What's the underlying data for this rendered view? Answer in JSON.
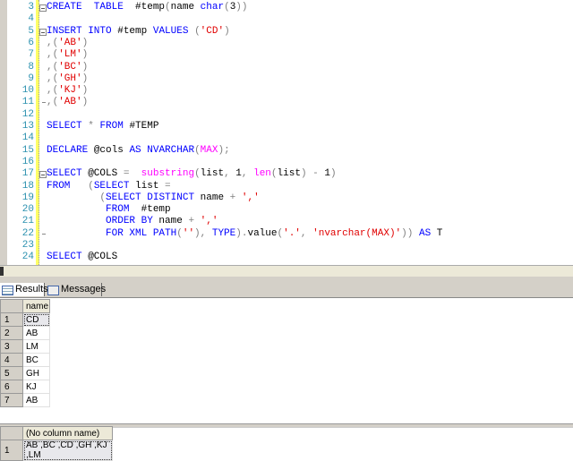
{
  "editor": {
    "lines": [
      {
        "n": "3",
        "fold": "start",
        "t": [
          [
            "kw",
            "CREATE  TABLE"
          ],
          [
            "tx",
            "  #temp"
          ],
          [
            "op",
            "("
          ],
          [
            "tx",
            "name "
          ],
          [
            "kw",
            "char"
          ],
          [
            "op",
            "("
          ],
          [
            "tx",
            "3"
          ],
          [
            "op",
            "))"
          ]
        ]
      },
      {
        "n": "4",
        "t": []
      },
      {
        "n": "5",
        "fold": "start",
        "t": [
          [
            "kw",
            "INSERT INTO"
          ],
          [
            "tx",
            " #temp "
          ],
          [
            "kw",
            "VALUES"
          ],
          [
            "tx",
            " "
          ],
          [
            "op",
            "("
          ],
          [
            "str",
            "'CD'"
          ],
          [
            "op",
            ")"
          ]
        ]
      },
      {
        "n": "6",
        "t": [
          [
            "op",
            ",("
          ],
          [
            "str",
            "'AB'"
          ],
          [
            "op",
            ")"
          ]
        ]
      },
      {
        "n": "7",
        "t": [
          [
            "op",
            ",("
          ],
          [
            "str",
            "'LM'"
          ],
          [
            "op",
            ")"
          ]
        ]
      },
      {
        "n": "8",
        "t": [
          [
            "op",
            ",("
          ],
          [
            "str",
            "'BC'"
          ],
          [
            "op",
            ")"
          ]
        ]
      },
      {
        "n": "9",
        "t": [
          [
            "op",
            ",("
          ],
          [
            "str",
            "'GH'"
          ],
          [
            "op",
            ")"
          ]
        ]
      },
      {
        "n": "10",
        "t": [
          [
            "op",
            ",("
          ],
          [
            "str",
            "'KJ'"
          ],
          [
            "op",
            ")"
          ]
        ]
      },
      {
        "n": "11",
        "fold": "end",
        "t": [
          [
            "op",
            ",("
          ],
          [
            "str",
            "'AB'"
          ],
          [
            "op",
            ")"
          ]
        ]
      },
      {
        "n": "12",
        "t": []
      },
      {
        "n": "13",
        "t": [
          [
            "kw",
            "SELECT"
          ],
          [
            "tx",
            " "
          ],
          [
            "op",
            "*"
          ],
          [
            "tx",
            " "
          ],
          [
            "kw",
            "FROM"
          ],
          [
            "tx",
            " #TEMP"
          ]
        ]
      },
      {
        "n": "14",
        "t": []
      },
      {
        "n": "15",
        "t": [
          [
            "kw",
            "DECLARE"
          ],
          [
            "tx",
            " @cols "
          ],
          [
            "kw",
            "AS NVARCHAR"
          ],
          [
            "op",
            "("
          ],
          [
            "fn",
            "MAX"
          ],
          [
            "op",
            ");"
          ]
        ]
      },
      {
        "n": "16",
        "t": []
      },
      {
        "n": "17",
        "fold": "start",
        "t": [
          [
            "kw",
            "SELECT"
          ],
          [
            "tx",
            " @COLS "
          ],
          [
            "op",
            "="
          ],
          [
            "tx",
            "  "
          ],
          [
            "fn",
            "substring"
          ],
          [
            "op",
            "("
          ],
          [
            "tx",
            "list"
          ],
          [
            "op",
            ","
          ],
          [
            "tx",
            " 1"
          ],
          [
            "op",
            ","
          ],
          [
            "tx",
            " "
          ],
          [
            "fn",
            "len"
          ],
          [
            "op",
            "("
          ],
          [
            "tx",
            "list"
          ],
          [
            "op",
            ")"
          ],
          [
            "tx",
            " "
          ],
          [
            "op",
            "-"
          ],
          [
            "tx",
            " 1"
          ],
          [
            "op",
            ")"
          ]
        ]
      },
      {
        "n": "18",
        "t": [
          [
            "kw",
            "FROM"
          ],
          [
            "tx",
            "   "
          ],
          [
            "op",
            "("
          ],
          [
            "kw",
            "SELECT"
          ],
          [
            "tx",
            " list "
          ],
          [
            "op",
            "="
          ]
        ]
      },
      {
        "n": "19",
        "t": [
          [
            "tx",
            "         "
          ],
          [
            "op",
            "("
          ],
          [
            "kw",
            "SELECT DISTINCT"
          ],
          [
            "tx",
            " name "
          ],
          [
            "op",
            "+"
          ],
          [
            "tx",
            " "
          ],
          [
            "str",
            "','"
          ]
        ]
      },
      {
        "n": "20",
        "t": [
          [
            "tx",
            "          "
          ],
          [
            "kw",
            "FROM"
          ],
          [
            "tx",
            "  #temp"
          ]
        ]
      },
      {
        "n": "21",
        "t": [
          [
            "tx",
            "          "
          ],
          [
            "kw",
            "ORDER BY"
          ],
          [
            "tx",
            " name "
          ],
          [
            "op",
            "+"
          ],
          [
            "tx",
            " "
          ],
          [
            "str",
            "','"
          ]
        ]
      },
      {
        "n": "22",
        "fold": "end",
        "t": [
          [
            "tx",
            "          "
          ],
          [
            "kw",
            "FOR XML PATH"
          ],
          [
            "op",
            "("
          ],
          [
            "str",
            "''"
          ],
          [
            "op",
            "),"
          ],
          [
            "tx",
            " "
          ],
          [
            "kw",
            "TYPE"
          ],
          [
            "op",
            ")."
          ],
          [
            "tx",
            "value"
          ],
          [
            "op",
            "("
          ],
          [
            "str",
            "'.'"
          ],
          [
            "op",
            ","
          ],
          [
            "tx",
            " "
          ],
          [
            "str",
            "'nvarchar(MAX)'"
          ],
          [
            "op",
            "))"
          ],
          [
            "tx",
            " "
          ],
          [
            "kw",
            "AS"
          ],
          [
            "tx",
            " T"
          ]
        ]
      },
      {
        "n": "23",
        "t": []
      },
      {
        "n": "24",
        "t": [
          [
            "kw",
            "SELECT"
          ],
          [
            "tx",
            " @COLS"
          ]
        ]
      }
    ]
  },
  "tabs": [
    {
      "label": "Results",
      "icon": "grid-icon"
    },
    {
      "label": "Messages",
      "icon": "messages-icon"
    }
  ],
  "grid1": {
    "header": "name",
    "rows": [
      [
        "1",
        "CD"
      ],
      [
        "2",
        "AB"
      ],
      [
        "3",
        "LM"
      ],
      [
        "4",
        "BC"
      ],
      [
        "5",
        "GH"
      ],
      [
        "6",
        "KJ"
      ],
      [
        "7",
        "AB"
      ]
    ]
  },
  "grid2": {
    "header": "(No column name)",
    "rows": [
      [
        "1",
        "AB ,BC ,CD ,GH ,KJ ,LM"
      ]
    ]
  }
}
